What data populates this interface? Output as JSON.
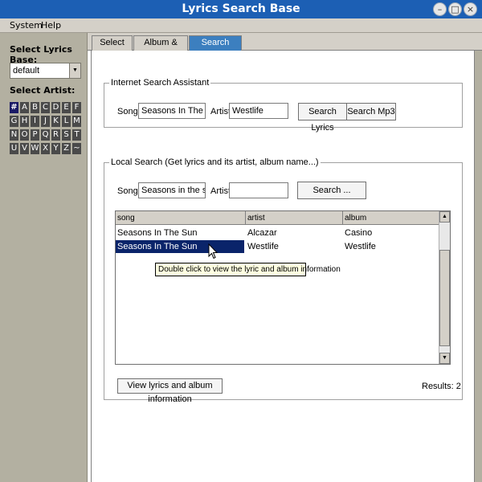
{
  "window": {
    "title": "Lyrics Search Base"
  },
  "menu": {
    "system": "System",
    "help": "Help"
  },
  "sidebar": {
    "lyrics_base_label": "Select Lyrics Base:",
    "lyrics_base_value": "default",
    "artist_label": "Select Artist:",
    "letters": [
      "#",
      "A",
      "B",
      "C",
      "D",
      "E",
      "F",
      "G",
      "H",
      "I",
      "J",
      "K",
      "L",
      "M",
      "N",
      "O",
      "P",
      "Q",
      "R",
      "S",
      "T",
      "U",
      "V",
      "W",
      "X",
      "Y",
      "Z",
      "~"
    ]
  },
  "tabs": [
    "Select Artist",
    "Album & Songs",
    "Search Lyrics"
  ],
  "internet_search": {
    "title": "Internet Search Assistant",
    "song_label": "Song:",
    "song_value": "Seasons In The Sun",
    "artist_label": "Artist:",
    "artist_value": "Westlife",
    "search_lyrics_btn": "Search Lyrics",
    "search_mp3_btn": "Search Mp3"
  },
  "local_search": {
    "title": "Local Search (Get lyrics and its artist, album name...)",
    "song_label": "Song:",
    "song_value": "Seasons in the sun",
    "artist_label": "Artist:",
    "artist_value": "",
    "search_btn": "Search ..."
  },
  "results_table": {
    "headers": [
      "song",
      "artist",
      "album"
    ],
    "rows": [
      [
        "Seasons In The Sun",
        "Alcazar",
        "Casino"
      ],
      [
        "Seasons In The Sun",
        "Westlife",
        "Westlife"
      ]
    ]
  },
  "tooltip": "Double click to view the lyric and album information",
  "view_btn": "View lyrics and album information",
  "results_text": "Results: 2"
}
